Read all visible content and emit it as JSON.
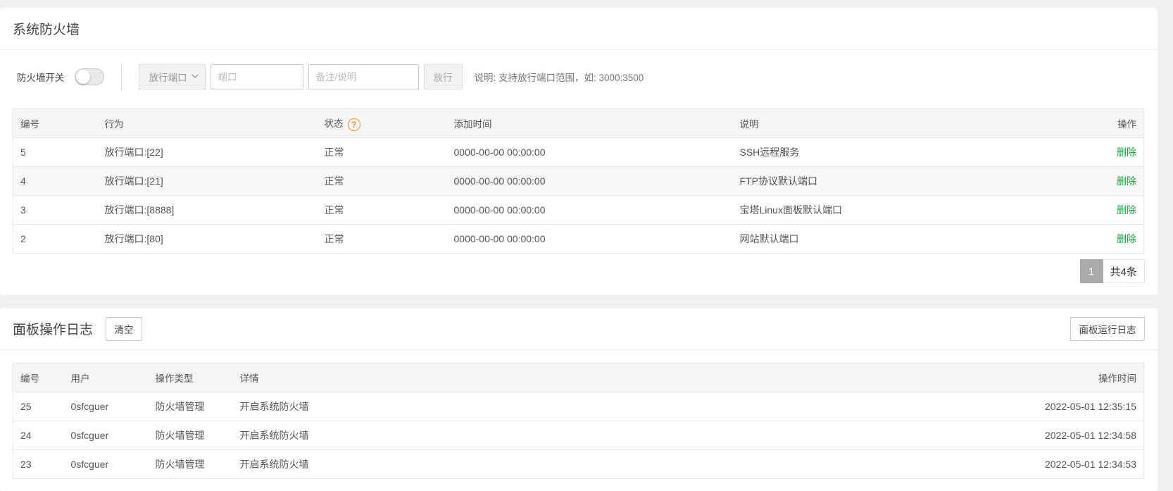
{
  "firewall": {
    "title": "系统防火墙",
    "switch_label": "防火墙开关",
    "switch_on": false,
    "select_value": "放行端口",
    "port_placeholder": "端口",
    "remark_placeholder": "备注/说明",
    "release_label": "放行",
    "hint": "说明: 支持放行端口范围，如: 3000:3500",
    "columns": [
      "编号",
      "行为",
      "状态",
      "添加时间",
      "说明",
      "操作"
    ],
    "rows": [
      {
        "id": "5",
        "action": "放行端口:[22]",
        "status": "正常",
        "time": "0000-00-00 00:00:00",
        "note": "SSH远程服务",
        "op": "删除"
      },
      {
        "id": "4",
        "action": "放行端口:[21]",
        "status": "正常",
        "time": "0000-00-00 00:00:00",
        "note": "FTP协议默认端口",
        "op": "删除"
      },
      {
        "id": "3",
        "action": "放行端口:[8888]",
        "status": "正常",
        "time": "0000-00-00 00:00:00",
        "note": "宝塔Linux面板默认端口",
        "op": "删除"
      },
      {
        "id": "2",
        "action": "放行端口:[80]",
        "status": "正常",
        "time": "0000-00-00 00:00:00",
        "note": "网站默认端口",
        "op": "删除"
      }
    ],
    "pager": {
      "current": "1",
      "total": "共4条"
    }
  },
  "log": {
    "title": "面板操作日志",
    "clear_label": "清空",
    "runlog_label": "面板运行日志",
    "columns": [
      "编号",
      "用户",
      "操作类型",
      "详情",
      "操作时间"
    ],
    "rows": [
      {
        "id": "25",
        "user": "0sfcguer",
        "type": "防火墙管理",
        "detail": "开启系统防火墙",
        "time": "2022-05-01 12:35:15"
      },
      {
        "id": "24",
        "user": "0sfcguer",
        "type": "防火墙管理",
        "detail": "开启系统防火墙",
        "time": "2022-05-01 12:34:58"
      },
      {
        "id": "23",
        "user": "0sfcguer",
        "type": "防火墙管理",
        "detail": "开启系统防火墙",
        "time": "2022-05-01 12:34:53"
      }
    ]
  },
  "colors": {
    "link_green": "#20a53a",
    "help_orange": "#f0932b"
  }
}
